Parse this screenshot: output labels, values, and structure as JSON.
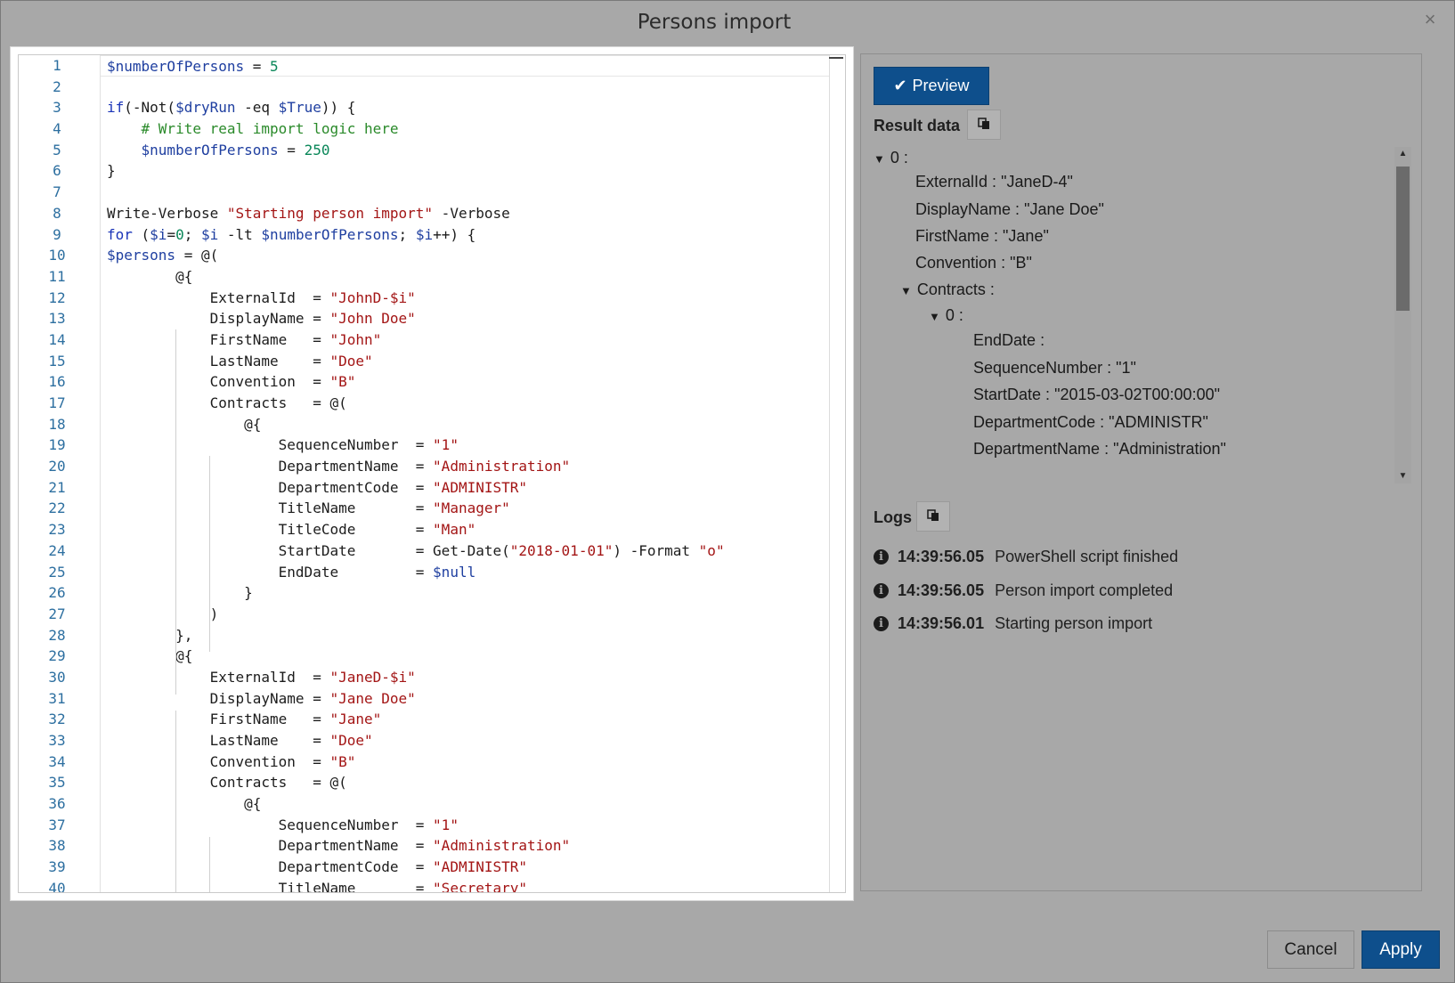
{
  "dialog": {
    "title": "Persons import",
    "close_glyph": "×"
  },
  "editor": {
    "line_numbers": [
      "1",
      "2",
      "3",
      "4",
      "5",
      "6",
      "7",
      "8",
      "9",
      "10",
      "11",
      "12",
      "13",
      "14",
      "15",
      "16",
      "17",
      "18",
      "19",
      "20",
      "21",
      "22",
      "23",
      "24",
      "25",
      "26",
      "27",
      "28",
      "29",
      "30",
      "31",
      "32",
      "33",
      "34",
      "35",
      "36",
      "37",
      "38",
      "39",
      "40"
    ]
  },
  "right_panel": {
    "preview_label": "Preview",
    "preview_icon": "check-icon",
    "result_label": "Result data",
    "logs_label": "Logs",
    "copy_icon": "clipboard-icon",
    "tree": [
      {
        "key": "0",
        "value": "",
        "expandable": true
      },
      {
        "key": "ExternalId",
        "value": "\"JaneD-4\""
      },
      {
        "key": "DisplayName",
        "value": "\"Jane Doe\""
      },
      {
        "key": "FirstName",
        "value": "\"Jane\""
      },
      {
        "key": "Convention",
        "value": "\"B\""
      },
      {
        "key": "Contracts",
        "value": "",
        "expandable": true
      },
      {
        "key": "0",
        "value": "",
        "expandable": true
      },
      {
        "key": "EndDate",
        "value": ""
      },
      {
        "key": "SequenceNumber",
        "value": "\"1\""
      },
      {
        "key": "StartDate",
        "value": "\"2015-03-02T00:00:00\""
      },
      {
        "key": "DepartmentCode",
        "value": "\"ADMINISTR\""
      },
      {
        "key": "DepartmentName",
        "value": "\"Administration\""
      }
    ],
    "logs": [
      {
        "time": "14:39:56.05",
        "message": "PowerShell script finished"
      },
      {
        "time": "14:39:56.05",
        "message": "Person import completed"
      },
      {
        "time": "14:39:56.01",
        "message": "Starting person import"
      }
    ]
  },
  "footer": {
    "cancel_label": "Cancel",
    "apply_label": "Apply"
  },
  "colors": {
    "primary": "#0e4f8c",
    "overlay": "#a8a8a8"
  }
}
